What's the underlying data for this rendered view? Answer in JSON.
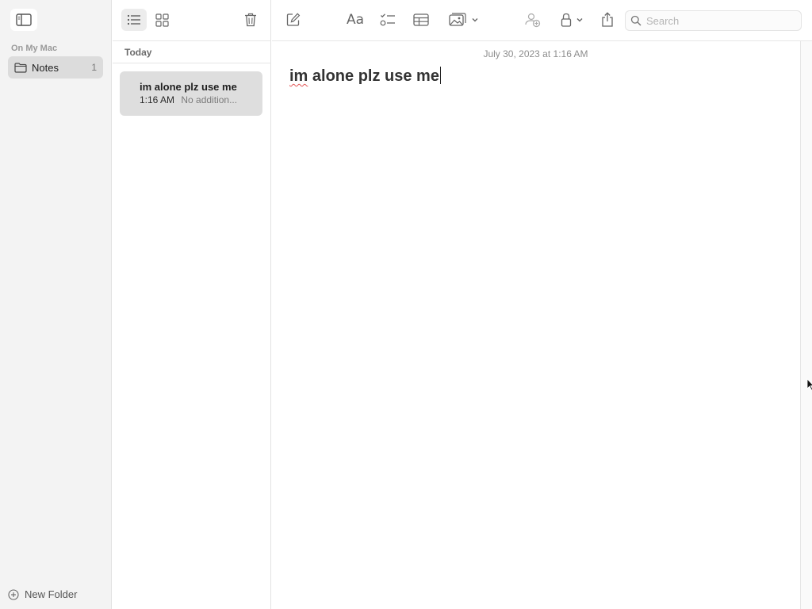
{
  "sidebar": {
    "section_label": "On My Mac",
    "folders": [
      {
        "label": "Notes",
        "count": "1",
        "selected": true
      }
    ],
    "new_folder_label": "New Folder"
  },
  "note_list": {
    "group_header": "Today",
    "notes": [
      {
        "title": "im alone plz use me",
        "time": "1:16 AM",
        "preview": "No addition..."
      }
    ]
  },
  "editor": {
    "toolbar": {
      "format_label": "Aa",
      "search_placeholder": "Search"
    },
    "date": "July 30, 2023 at 1:16 AM",
    "content_misspelled": "im",
    "content_rest": " alone plz use me"
  },
  "icons": {
    "sidebar_toggle": "sidebar-toggle-icon",
    "folder": "folder-icon",
    "new_folder": "plus-circle-icon",
    "list_view": "list-view-icon",
    "gallery_view": "grid-view-icon",
    "delete": "trash-icon",
    "compose": "compose-icon",
    "checklist": "checklist-icon",
    "table": "table-icon",
    "media": "photo-icon",
    "collaborate": "collaborate-icon",
    "lock": "lock-icon",
    "share": "share-icon",
    "search": "search-icon"
  },
  "colors": {
    "sidebar_bg": "#f3f3f3",
    "selected_bg": "#dcdcdc",
    "note_selected_bg": "#dedede",
    "icon_gray": "#6f6f6f",
    "spell_underline": "#e25555"
  }
}
